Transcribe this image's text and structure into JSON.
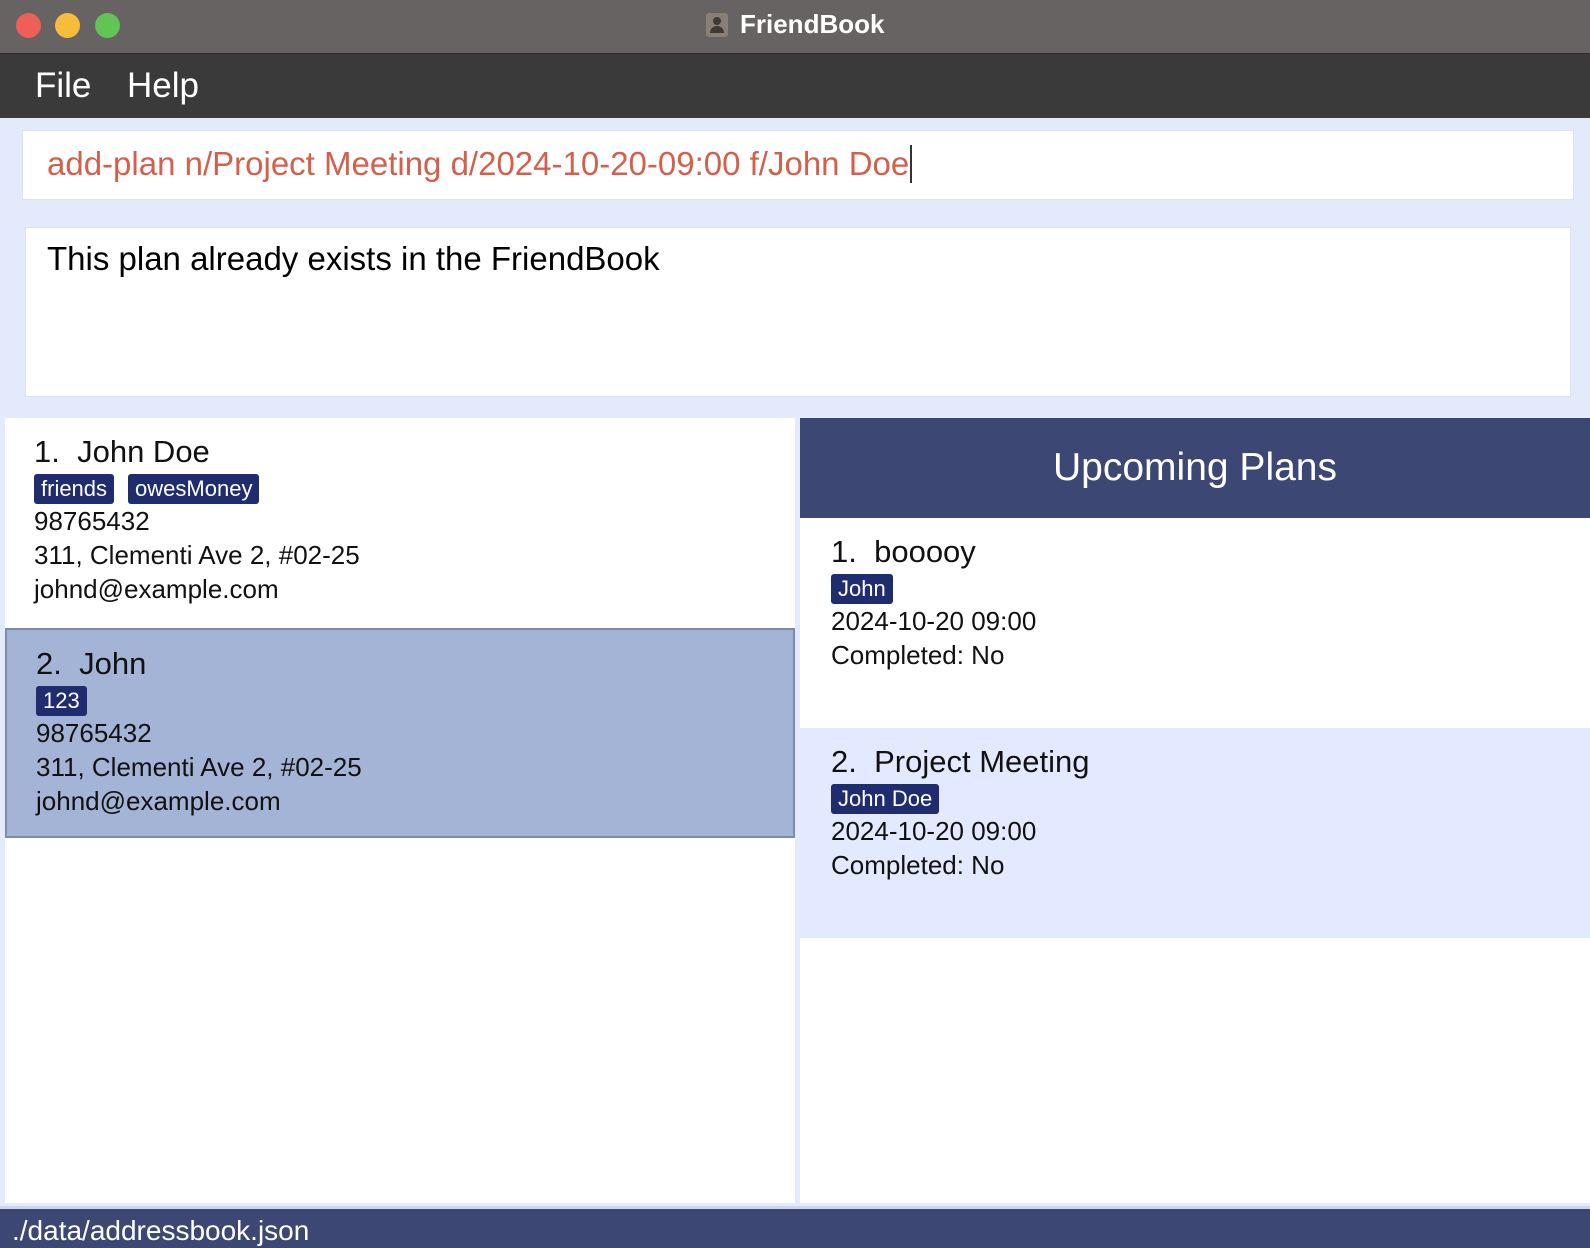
{
  "window": {
    "title": "FriendBook"
  },
  "menu": {
    "file": "File",
    "help": "Help"
  },
  "command": {
    "value": "add-plan n/Project Meeting d/2024-10-20-09:00 f/John Doe"
  },
  "result": {
    "message": "This plan already exists in the FriendBook"
  },
  "persons": [
    {
      "index": "1.",
      "name": "John Doe",
      "tags": [
        "friends",
        "owesMoney"
      ],
      "phone": "98765432",
      "address": "311, Clementi Ave 2, #02-25",
      "email": "johnd@example.com"
    },
    {
      "index": "2.",
      "name": "John",
      "tags": [
        "123"
      ],
      "phone": "98765432",
      "address": "311, Clementi Ave 2, #02-25",
      "email": "johnd@example.com"
    }
  ],
  "plans": {
    "header": "Upcoming Plans",
    "items": [
      {
        "index": "1.",
        "name": "booooy",
        "friend": "John",
        "datetime": "2024-10-20 09:00",
        "completed": "Completed: No"
      },
      {
        "index": "2.",
        "name": "Project Meeting",
        "friend": "John Doe",
        "datetime": "2024-10-20 09:00",
        "completed": "Completed: No"
      }
    ]
  },
  "status": {
    "path": "./data/addressbook.json"
  },
  "colors": {
    "accent": "#3d4774",
    "tag": "#1f2d6e",
    "selected": "#a4b4d6",
    "command_text": "#d3604b"
  }
}
